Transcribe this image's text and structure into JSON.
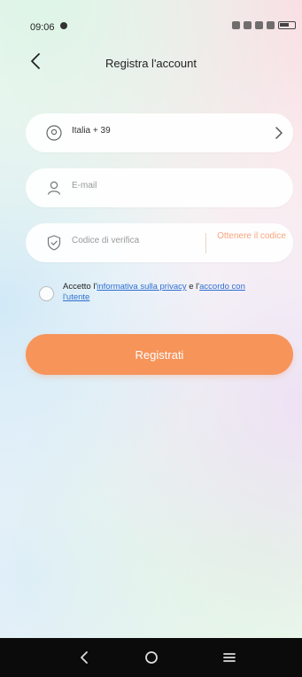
{
  "status_bar": {
    "time": "09:06"
  },
  "header": {
    "title": "Registra l'account"
  },
  "country_field": {
    "value": "Italia + 39"
  },
  "email_field": {
    "placeholder": "E-mail"
  },
  "code_field": {
    "placeholder": "Codice di verifica",
    "get_code_label": "Ottenere il codice"
  },
  "agreement": {
    "prefix": "Accetto l'",
    "privacy_link": "informativa sulla privacy",
    "middle": " e l'",
    "terms_link_part1": "accordo con",
    "terms_link_part2": "l'utente"
  },
  "register_button": {
    "label": "Registrati"
  },
  "colors": {
    "accent": "#f6945a",
    "link": "#2f6fd1"
  },
  "icons": [
    "back-arrow-icon",
    "location-pin-icon",
    "person-icon",
    "shield-check-icon",
    "chevron-right-icon"
  ]
}
